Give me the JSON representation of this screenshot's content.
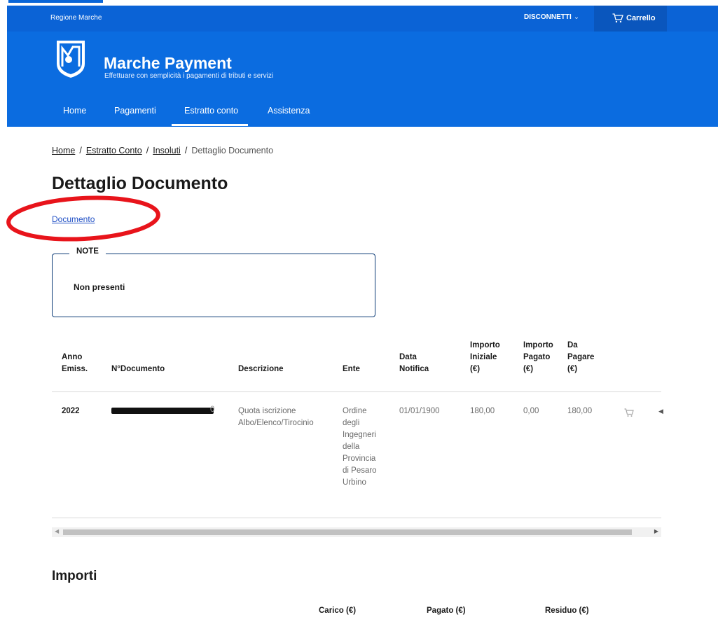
{
  "top_bar": {
    "region": "Regione Marche",
    "logout_label": "DISCONNETTI",
    "logout_chevron": "⌄",
    "cart_label": "Carrello",
    "cart_icon": "shopping-cart-icon"
  },
  "header": {
    "title": "Marche Payment",
    "subtitle": "Effettuare con semplicità i pagamenti di tributi e servizi",
    "logo_icon": "regione-marche-logo-icon"
  },
  "nav": {
    "items": [
      {
        "label": "Home",
        "active": false
      },
      {
        "label": "Pagamenti",
        "active": false
      },
      {
        "label": "Estratto conto",
        "active": true
      },
      {
        "label": "Assistenza",
        "active": false
      }
    ]
  },
  "breadcrumb": {
    "items": [
      {
        "label": "Home",
        "link": true
      },
      {
        "label": "Estratto Conto",
        "link": true
      },
      {
        "label": "Insoluti",
        "link": true
      },
      {
        "label": "Dettaglio Documento",
        "link": false
      }
    ],
    "separator": "/"
  },
  "page": {
    "title": "Dettaglio Documento",
    "document_link": "Documento"
  },
  "note": {
    "legend": "NOTE",
    "value": "Non presenti"
  },
  "table": {
    "headers": {
      "year": [
        "Anno",
        "Emiss."
      ],
      "number": [
        "N°Documento"
      ],
      "description": [
        "Descrizione"
      ],
      "entity": [
        "Ente"
      ],
      "notify": [
        "Data",
        "Notifica"
      ],
      "initial": [
        "Importo",
        "Iniziale",
        "(€)"
      ],
      "paid": [
        "Importo",
        "Pagato",
        "(€)"
      ],
      "due": [
        "Da",
        "Pagare",
        "(€)"
      ]
    },
    "row": {
      "year": "2022",
      "number_tail": "0",
      "description": [
        "Quota iscrizione",
        "Albo/Elenco/Tirocinio"
      ],
      "entity": [
        "Ordine",
        "degli",
        "Ingegneri",
        "della",
        "Provincia",
        "di Pesaro",
        "Urbino"
      ],
      "notify": "01/01/1900",
      "initial": "180,00",
      "paid": "0,00",
      "due": "180,00",
      "cart_icon": "add-to-cart-icon",
      "more_icon": "caret-left-icon"
    }
  },
  "scrollbar": {
    "left_arrow": "◀",
    "right_arrow": "▶"
  },
  "importi": {
    "title": "Importi",
    "headers": [
      "Carico (€)",
      "Pagato (€)",
      "Residuo (€)"
    ]
  },
  "colors": {
    "brand_blue": "#0b6ce0",
    "top_bar_blue": "#0b63d6",
    "cart_blue": "#0a56bd",
    "link_blue": "#2352c6",
    "annotation_red": "#e8141b"
  }
}
